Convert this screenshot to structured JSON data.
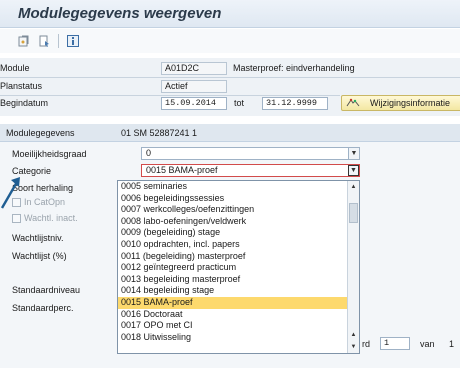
{
  "header": {
    "title": "Modulegegevens weergeven"
  },
  "toolbar": {
    "icons": [
      "display-icon",
      "page-icon",
      "info-icon"
    ]
  },
  "top_fields": {
    "module_label": "Module",
    "module_value": "A01D2C",
    "module_desc": "Masterproef: eindverhandeling",
    "planstatus_label": "Planstatus",
    "planstatus_value": "Actief",
    "begindatum_label": "Begindatum",
    "begindatum_value": "15.09.2014",
    "tot_label": "tot",
    "einddatum_value": "31.12.9999",
    "wijzigings_button": "Wijzigingsinformatie"
  },
  "section": {
    "header_label": "Modulegegevens",
    "header_value": "01 SM 52887241 1",
    "moeilijkheid_label": "Moeilijkheidsgraad",
    "moeilijkheid_value": "0",
    "categorie_label": "Categorie",
    "categorie_value": "0015 BAMA-proef",
    "soort_label": "Soort herhaling",
    "in_catopn_label": "In CatOpn",
    "wachtl_inact_label": "Wachtl. inact.",
    "wachtlijstniv_label": "Wachtlijstniv.",
    "wachtlijst_pct_label": "Wachtlijst (%)",
    "standaardniveau_label": "Standaardniveau",
    "standaardperc_label": "Standaardperc.",
    "record_label": "rd",
    "record_value": "1",
    "van_label": "van",
    "van_value": "1"
  },
  "dropdown_options": [
    "0005 seminaries",
    "0006 begeleidingssessies",
    "0007 werkcolleges/oefenzittingen",
    "0008 labo-oefeningen/veldwerk",
    "0009 (begeleiding) stage",
    "0010 opdrachten, incl. papers",
    "0011 (begeleiding) masterproef",
    "0012 geïntegreerd practicum",
    "0013 begeleiding masterproef",
    "0014 begeleiding stage",
    "0015 BAMA-proef",
    "0016 Doctoraat",
    "0017 OPO met CI",
    "0018 Uitwisseling"
  ],
  "selected_option_index": 10,
  "colors": {
    "selected_bg": "#fdd96d",
    "accent_border": "#d24b4b",
    "pointer": "#1f5e93"
  }
}
